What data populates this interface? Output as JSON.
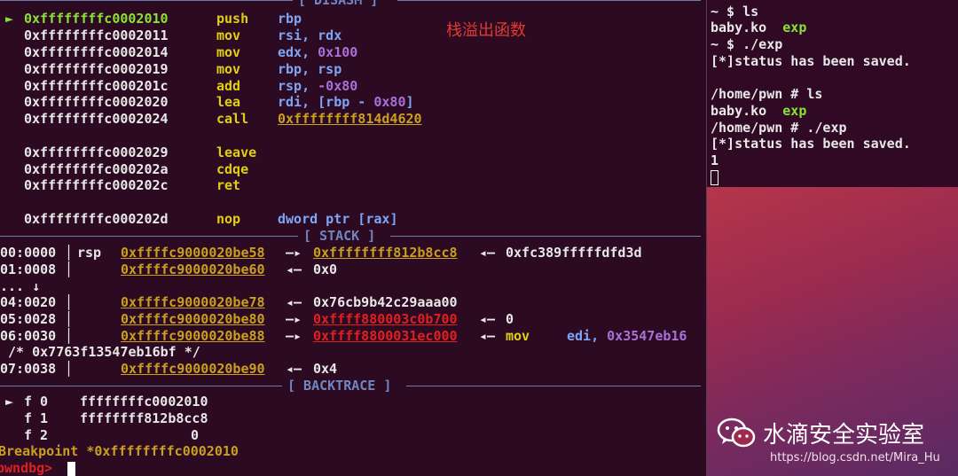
{
  "disasm": {
    "title": "[ DISASM ]",
    "note": "栈溢出函数",
    "marker": "►",
    "lines": [
      {
        "addr": "0xffffffffc0002010",
        "mnem": "push",
        "op1": "rbp",
        "op2": ""
      },
      {
        "addr": "0xffffffffc0002011",
        "mnem": "mov",
        "op1": "rsi, ",
        "op2": "rdx"
      },
      {
        "addr": "0xffffffffc0002014",
        "mnem": "mov",
        "op1": "edx, ",
        "op2": "0x100"
      },
      {
        "addr": "0xffffffffc0002019",
        "mnem": "mov",
        "op1": "rbp, ",
        "op2": "rsp"
      },
      {
        "addr": "0xffffffffc000201c",
        "mnem": "add",
        "op1": "rsp, ",
        "op2": "-0x80"
      },
      {
        "addr": "0xffffffffc0002020",
        "mnem": "lea",
        "op1": "rdi, [rbp - ",
        "op2": "0x80",
        "op3": "]"
      },
      {
        "addr": "0xffffffffc0002024",
        "mnem": "call",
        "op1": "0xffffffff814d4620",
        "op2": ""
      },
      {
        "addr": "0xffffffffc0002029",
        "mnem": "leave",
        "op1": "",
        "op2": ""
      },
      {
        "addr": "0xffffffffc000202a",
        "mnem": "cdqe",
        "op1": "",
        "op2": ""
      },
      {
        "addr": "0xffffffffc000202c",
        "mnem": "ret",
        "op1": "",
        "op2": ""
      },
      {
        "addr": "0xffffffffc000202d",
        "mnem": "nop",
        "op1": "dword ptr [",
        "op2": "rax",
        "op3": "]"
      }
    ]
  },
  "stack": {
    "title": "[ STACK ]",
    "rows": [
      {
        "idx": "00:0000",
        "reg": "rsp",
        "addr": "0xffffc9000020be58",
        "arrow": "—▸",
        "ptr": "0xffffffff812b8cc8",
        "arrow2": "◂—",
        "val": "0xfc389fffffdfd3d"
      },
      {
        "idx": "01:0008",
        "reg": "",
        "addr": "0xffffc9000020be60",
        "arrow": "◂—",
        "val": "0x0"
      },
      {
        "idx": "... ↓",
        "reg": ""
      },
      {
        "idx": "04:0020",
        "reg": "",
        "addr": "0xffffc9000020be78",
        "arrow": "◂—",
        "val": "0x76cb9b42c29aaa00"
      },
      {
        "idx": "05:0028",
        "reg": "",
        "addr": "0xffffc9000020be80",
        "arrow": "—▸",
        "ptr": "0xffff880003c0b700",
        "arrow2": "◂—",
        "val": "0"
      },
      {
        "idx": "06:0030",
        "reg": "",
        "addr": "0xffffc9000020be88",
        "arrow": "—▸",
        "ptr": "0xffff8800031ec000",
        "arrow2": "◂—",
        "val": "mov",
        "op": "edi, ",
        "opval": "0x3547eb16"
      },
      {
        "idx": " /* 0x7763f13547eb16bf */",
        "reg": ""
      },
      {
        "idx": "07:0038",
        "reg": "",
        "addr": "0xffffc9000020be90",
        "arrow": "◂—",
        "val": "0x4"
      }
    ]
  },
  "backtrace": {
    "title": "[ BACKTRACE ]",
    "frames": [
      {
        "marker": "►",
        "label": "f 0",
        "addr": "ffffffffc0002010"
      },
      {
        "marker": "",
        "label": "f 1",
        "addr": "ffffffff812b8cc8"
      },
      {
        "marker": "",
        "label": "f 2",
        "addr": "0"
      }
    ],
    "breakpoint": "Breakpoint *0xffffffffc0002010",
    "prompt": "pwndbg>"
  },
  "right_terminal": {
    "lines": [
      {
        "text": "~ $ ls"
      },
      {
        "file1": "baby.ko",
        "file2": "exp"
      },
      {
        "text": "~ $ ./exp"
      },
      {
        "text": "[*]status has been saved."
      },
      {
        "text": ""
      },
      {
        "text": "/home/pwn # ls"
      },
      {
        "file1": "baby.ko",
        "file2": "exp"
      },
      {
        "text": "/home/pwn # ./exp"
      },
      {
        "text": "[*]status has been saved."
      },
      {
        "text": "1"
      }
    ]
  },
  "watermark": {
    "name": "水滴安全实验室",
    "url": "https://blog.csdn.net/Mira_Hu",
    "icon": "wechat-icon"
  },
  "colors": {
    "bg": "#2c0a22",
    "green": "#8ae234",
    "yellow": "#e0d015",
    "blue": "#7fa6f4",
    "magenta": "#a970d9",
    "red": "#e02020",
    "orange": "#c8a020"
  }
}
